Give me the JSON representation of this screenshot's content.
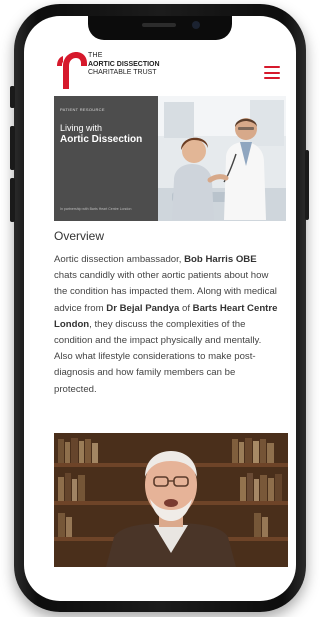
{
  "logo": {
    "line1": "THE",
    "line2": "AORTIC DISSECTION",
    "line3": "CHARITABLE TRUST"
  },
  "hero": {
    "small_label": "PATIENT RESOURCE",
    "title_line1": "Living with",
    "title_line2": "Aortic Dissection",
    "credit": "In partnership with Barts Heart Centre London"
  },
  "overview_heading": "Overview",
  "paragraph": {
    "p1": "Aortic dissection ambassador, ",
    "b1": "Bob Harris OBE",
    "p2": " chats candidly with other aortic patients about how the condition has impacted them. Along with medical advice from ",
    "b2": "Dr Bejal Pandya",
    "p3": " of ",
    "b3": "Barts Heart Centre London",
    "p4": ", they discuss the complexities of the condition and the impact physically and mentally. Also what lifestyle considerations to make post-diagnosis and how family members can be protected."
  },
  "colors": {
    "brand_red": "#d6192c",
    "hero_panel": "#4d4d4d"
  },
  "icons": {
    "menu": "hamburger-menu-icon",
    "logo": "aortic-arch-logo-icon"
  }
}
